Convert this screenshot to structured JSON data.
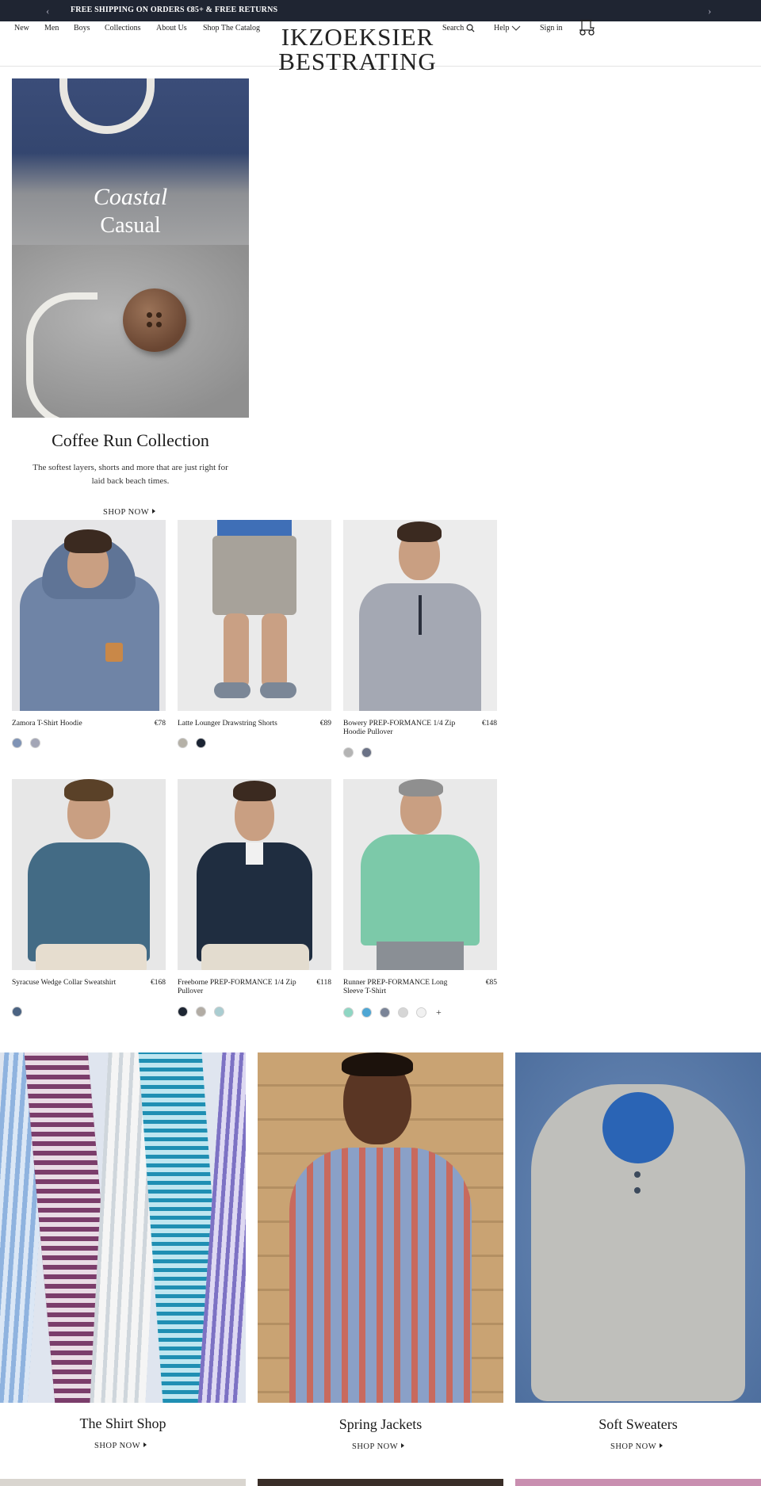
{
  "announcement": {
    "prev_icon": "chevron-left-icon",
    "next_icon": "chevron-right-icon",
    "message": "FREE SHIPPING ON ORDERS €85+ & FREE RETURNS"
  },
  "header": {
    "nav": [
      "New",
      "Men",
      "Boys",
      "Collections",
      "About Us",
      "Shop The Catalog"
    ],
    "logo_line1": "IKZOEKSIER",
    "logo_line2": "BESTRATING",
    "search_label": "Search",
    "help_label": "Help",
    "signin_label": "Sign in",
    "cart_icon": "golf-cart-icon"
  },
  "hero": {
    "headline_italic": "Coastal",
    "headline": "Casual",
    "collection_title": "Coffee Run Collection",
    "description": "The softest layers, shorts and more that are just right for laid back beach times.",
    "cta": "SHOP NOW"
  },
  "products": [
    {
      "name": "Zamora T-Shirt Hoodie",
      "price": "€78",
      "swatches": [
        "#7f93b5",
        "#a3a6b6"
      ]
    },
    {
      "name": "Latte Lounger Drawstring Shorts",
      "price": "€89",
      "swatches": [
        "#b5b1a7",
        "#1b2433"
      ]
    },
    {
      "name": "Bowery PREP-FORMANCE 1/4 Zip Hoodie Pullover",
      "price": "€148",
      "swatches": [
        "#b4b4b4",
        "#6b7286"
      ]
    },
    {
      "name": "Syracuse Wedge Collar Sweatshirt",
      "price": "€168",
      "swatches": [
        "#4b6382"
      ]
    },
    {
      "name": "Freeborne PREP-FORMANCE 1/4 Zip Pullover",
      "price": "€118",
      "swatches": [
        "#1e2633",
        "#b2aca4",
        "#aacdd1"
      ]
    },
    {
      "name": "Runner PREP-FORMANCE Long Sleeve T-Shirt",
      "price": "€85",
      "swatches": [
        "#8fd6c3",
        "#4ea6d4",
        "#7a8497",
        "#d6d6d6",
        "#f1f1f1"
      ],
      "more": "+"
    }
  ],
  "categories": [
    {
      "title": "The Shirt Shop",
      "cta": "SHOP NOW"
    },
    {
      "title": "Spring Jackets",
      "cta": "SHOP NOW"
    },
    {
      "title": "Soft Sweaters",
      "cta": "SHOP NOW"
    }
  ]
}
